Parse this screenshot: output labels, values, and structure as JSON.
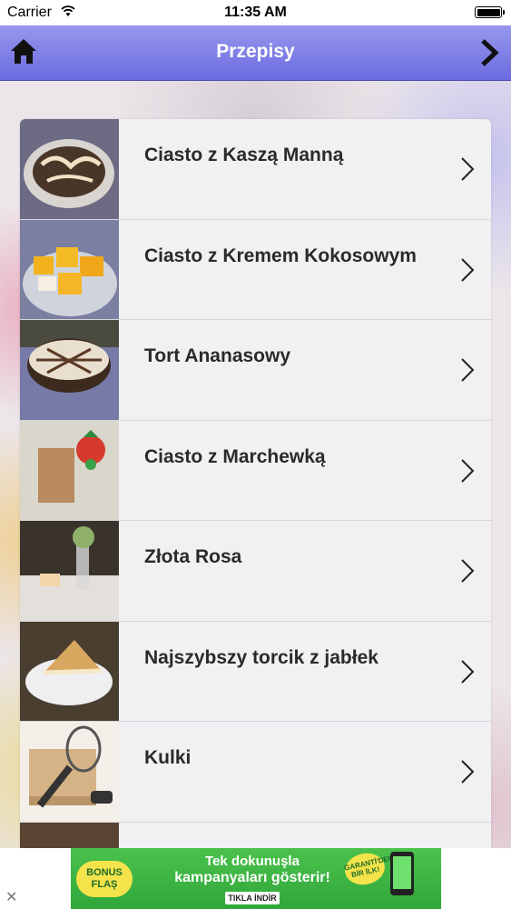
{
  "status_bar": {
    "carrier": "Carrier",
    "time": "11:35 AM"
  },
  "nav": {
    "title": "Przepisy",
    "home_icon": "home-icon",
    "forward_icon": "chevron-right-icon"
  },
  "recipes": [
    {
      "title": "Ciasto z Kaszą Manną"
    },
    {
      "title": "Ciasto z Kremem Kokosowym"
    },
    {
      "title": "Tort Ananasowy"
    },
    {
      "title": "Ciasto z Marchewką"
    },
    {
      "title": "Złota Rosa"
    },
    {
      "title": "Najszybszy torcik z jabłek"
    },
    {
      "title": "Kulki"
    },
    {
      "title": ""
    }
  ],
  "ad": {
    "close": "✕",
    "badge": "BONUS FLAŞ",
    "line1": "Tek dokunuşla",
    "line2": "kampanyaları gösterir!",
    "cta": "TIKLA İNDİR",
    "guarantee": "GARANTİ'DEN BİR İLK!"
  }
}
